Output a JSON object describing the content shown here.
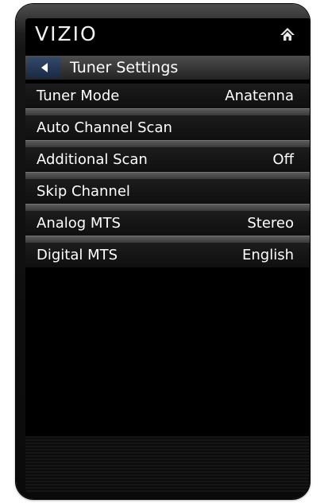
{
  "brand": "VIZIO",
  "icons": {
    "home": "home-icon",
    "back": "back-arrow-icon"
  },
  "title_bar": {
    "title": "Tuner Settings"
  },
  "menu": [
    {
      "label": "Tuner Mode",
      "value": "Anatenna"
    },
    {
      "label": "Auto Channel Scan",
      "value": ""
    },
    {
      "label": "Additional Scan",
      "value": "Off"
    },
    {
      "label": "Skip Channel",
      "value": ""
    },
    {
      "label": "Analog MTS",
      "value": "Stereo"
    },
    {
      "label": "Digital MTS",
      "value": "English"
    }
  ],
  "colors": {
    "back_button": "#24385a",
    "background": "#000000"
  }
}
